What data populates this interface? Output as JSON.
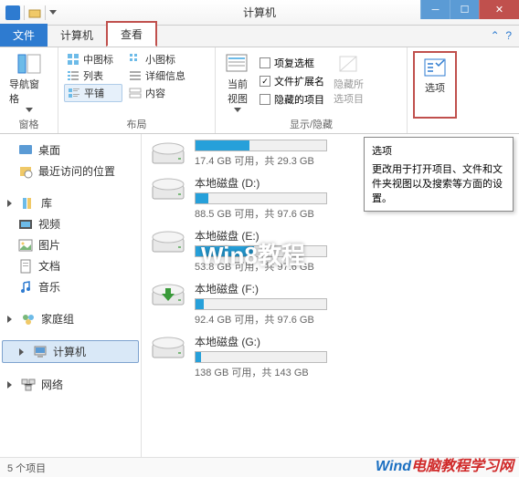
{
  "window": {
    "title": "计算机"
  },
  "tabs": {
    "file": "文件",
    "computer": "计算机",
    "view": "查看"
  },
  "ribbon": {
    "group1": {
      "nav_pane": "导航窗格",
      "label": "窗格"
    },
    "group2": {
      "medium": "中图标",
      "small": "小图标",
      "list": "列表",
      "details": "详细信息",
      "tiles": "平铺",
      "content": "内容",
      "label": "布局"
    },
    "group3": {
      "current_view": "当前\n视图",
      "item_checkbox": "项复选框",
      "file_ext": "文件扩展名",
      "hidden_items": "隐藏的项目",
      "hide_selected": "隐藏所\n选项目",
      "label": "显示/隐藏"
    },
    "group4": {
      "options": "选项"
    }
  },
  "sidebar": {
    "desktop": "桌面",
    "recent": "最近访问的位置",
    "libs": "库",
    "videos": "视频",
    "pictures": "图片",
    "documents": "文档",
    "music": "音乐",
    "homegroup": "家庭组",
    "computer": "计算机",
    "network": "网络"
  },
  "drives": [
    {
      "name": "",
      "size_text": "17.4 GB 可用，共 29.3 GB",
      "fill": 41,
      "low": false
    },
    {
      "name": "本地磁盘 (D:)",
      "size_text": "88.5 GB 可用，共 97.6 GB",
      "fill": 10,
      "low": false
    },
    {
      "name": "本地磁盘 (E:)",
      "size_text": "53.8 GB 可用，共 97.6 GB",
      "fill": 45,
      "low": false
    },
    {
      "name": "本地磁盘 (F:)",
      "size_text": "92.4 GB 可用，共 97.6 GB",
      "fill": 6,
      "low": false
    },
    {
      "name": "本地磁盘 (G:)",
      "size_text": "138 GB 可用，共 143 GB",
      "fill": 4,
      "low": false
    }
  ],
  "tooltip": {
    "title": "选项",
    "body": "更改用于打开项目、文件和文件夹视图以及搜索等方面的设置。"
  },
  "status": {
    "text": "5 个项目"
  },
  "watermark": {
    "brand": "Wind",
    "site": "电脑教程学习网",
    "center": "Win8教程"
  }
}
